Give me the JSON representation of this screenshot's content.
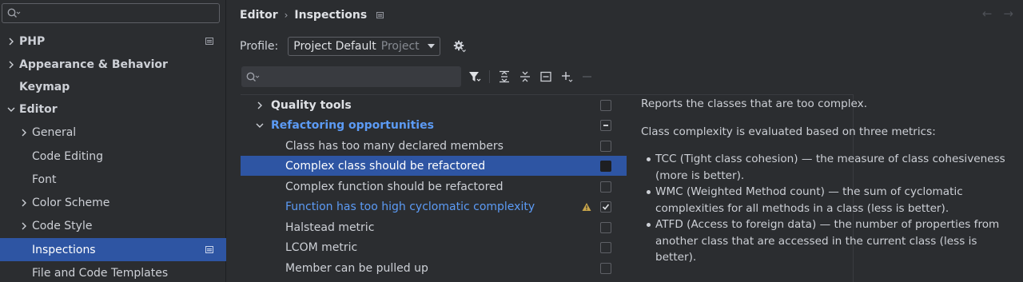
{
  "sidebar": {
    "search_placeholder": "",
    "items": [
      {
        "label": "PHP",
        "expandable": true,
        "expanded": false
      },
      {
        "label": "Appearance & Behavior",
        "expandable": true,
        "expanded": false
      },
      {
        "label": "Keymap",
        "expandable": false
      },
      {
        "label": "Editor",
        "expandable": true,
        "expanded": true
      },
      {
        "label": "General",
        "expandable": true,
        "expanded": false
      },
      {
        "label": "Code Editing",
        "expandable": false
      },
      {
        "label": "Font",
        "expandable": false
      },
      {
        "label": "Color Scheme",
        "expandable": true,
        "expanded": false
      },
      {
        "label": "Code Style",
        "expandable": true,
        "expanded": false
      },
      {
        "label": "Inspections",
        "expandable": false,
        "selected": true
      },
      {
        "label": "File and Code Templates",
        "expandable": false
      }
    ]
  },
  "header": {
    "breadcrumb_parent": "Editor",
    "breadcrumb_separator": "›",
    "breadcrumb_current": "Inspections",
    "nav_back": "←",
    "nav_forward": "→"
  },
  "profile": {
    "label": "Profile:",
    "value": "Project Default",
    "scope": "Project"
  },
  "inspection_search": {
    "placeholder": ""
  },
  "tree": {
    "rows": [
      {
        "label": "Quality tools",
        "type": "group",
        "expanded": false,
        "checked": "none"
      },
      {
        "label": "Refactoring opportunities",
        "type": "group",
        "expanded": true,
        "checked": "partial",
        "highlight": true
      },
      {
        "label": "Class has too many declared members",
        "type": "item",
        "checked": "none"
      },
      {
        "label": "Complex class should be refactored",
        "type": "item",
        "checked": "none",
        "selected": true
      },
      {
        "label": "Complex function should be refactored",
        "type": "item",
        "checked": "none"
      },
      {
        "label": "Function has too high cyclomatic complexity",
        "type": "item",
        "checked": "checked",
        "highlight": true,
        "warning": true
      },
      {
        "label": "Halstead metric",
        "type": "item",
        "checked": "none"
      },
      {
        "label": "LCOM metric",
        "type": "item",
        "checked": "none"
      },
      {
        "label": "Member can be pulled up",
        "type": "item",
        "checked": "none"
      }
    ]
  },
  "description": {
    "intro": "Reports the classes that are too complex.",
    "metrics_intro": "Class complexity is evaluated based on three metrics:",
    "bullets": [
      "TCC (Tight class cohesion) — the measure of class cohesiveness (more is better).",
      "WMC (Weighted Method count) — the sum of cyclomatic complexities for all methods in a class (less is better).",
      "ATFD (Access to foreign data) — the number of properties from another class that are accessed in the current class (less is better)."
    ]
  },
  "colors": {
    "background": "#2b2d30",
    "selection": "#2e55a3",
    "accent_blue": "#5c9bf5",
    "text": "#cdd0d6"
  }
}
